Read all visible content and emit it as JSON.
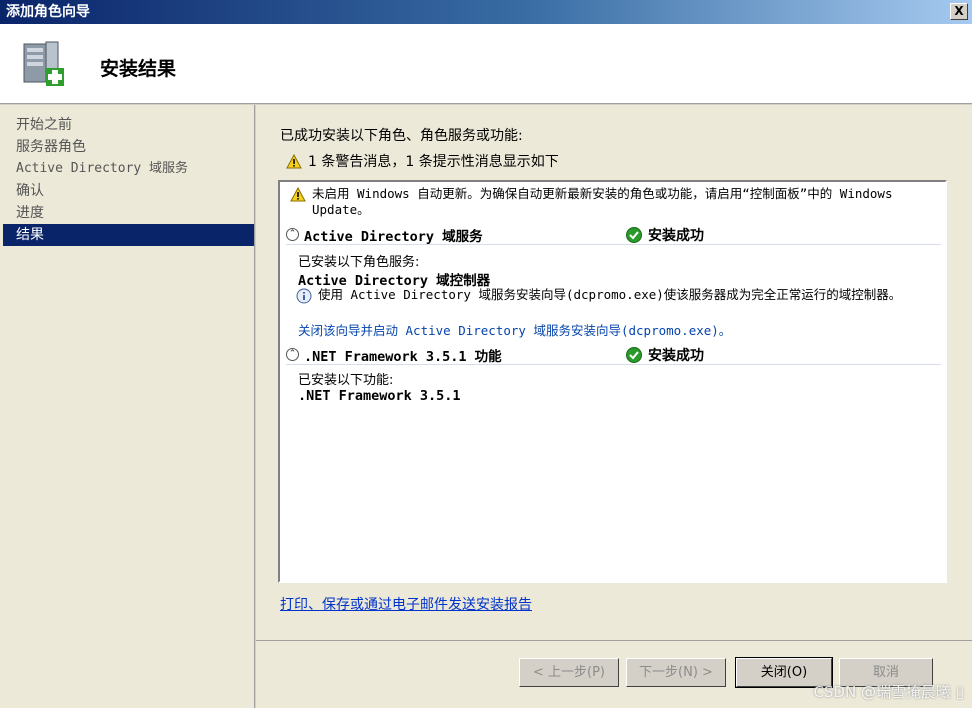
{
  "window": {
    "title": "添加角色向导",
    "close_label": "X"
  },
  "header": {
    "title": "安装结果"
  },
  "sidebar": {
    "items": [
      {
        "label": "开始之前"
      },
      {
        "label": "服务器角色"
      },
      {
        "label": "Active Directory 域服务"
      },
      {
        "label": "确认"
      },
      {
        "label": "进度"
      },
      {
        "label": "结果"
      }
    ],
    "active_index": 5
  },
  "main": {
    "intro": "已成功安装以下角色、角色服务或功能:",
    "summary": "1 条警告消息，1 条提示性消息显示如下",
    "warning_note": "未启用 Windows 自动更新。为确保自动更新最新安装的角色或功能，请启用“控制面板”中的 Windows Update。",
    "sections": [
      {
        "title": "Active Directory 域服务",
        "status": "安装成功",
        "installed_label": "已安装以下角色服务:",
        "item": "Active Directory 域控制器",
        "info": "使用 Active Directory 域服务安装向导(dcpromo.exe)使该服务器成为完全正常运行的域控制器。",
        "link": "关闭该向导并启动 Active Directory 域服务安装向导(dcpromo.exe)。"
      },
      {
        "title": ".NET Framework 3.5.1 功能",
        "status": "安装成功",
        "installed_label": "已安装以下功能:",
        "item": ".NET Framework 3.5.1"
      }
    ],
    "report_link": "打印、保存或通过电子邮件发送安装报告"
  },
  "footer": {
    "back": "< 上一步(P)",
    "next": "下一步(N) >",
    "close": "关闭(O)",
    "cancel": "取消"
  },
  "watermark": "CSDN @瑞雪掩晨曦 ▯"
}
